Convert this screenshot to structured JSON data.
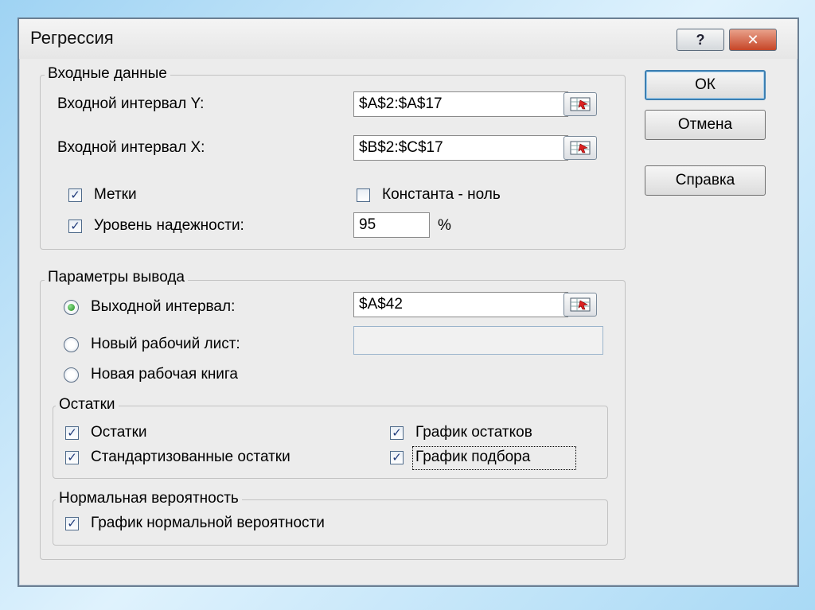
{
  "dialog": {
    "title": "Регрессия",
    "help_button": "?",
    "close_button": "✕"
  },
  "input": {
    "legend": "Входные данные",
    "y_label": "Входной интервал Y:",
    "y_value": "$A$2:$A$17",
    "x_label": "Входной интервал X:",
    "x_value": "$B$2:$C$17",
    "labels_label": "Метки",
    "labels_checked": true,
    "const_label": "Константа - ноль",
    "const_checked": false,
    "confidence_label": "Уровень надежности:",
    "confidence_checked": true,
    "confidence_value": "95",
    "percent": "%"
  },
  "output": {
    "legend": "Параметры вывода",
    "range_label": "Выходной интервал:",
    "range_value": "$A$42",
    "new_sheet_label": "Новый рабочий лист:",
    "new_sheet_value": "",
    "new_book_label": "Новая рабочая книга",
    "selected": "range"
  },
  "residuals": {
    "legend": "Остатки",
    "residuals_label": "Остатки",
    "standardized_label": "Стандартизованные остатки",
    "residual_plot_label": "График остатков",
    "fit_plot_label": "График подбора",
    "all_checked": true
  },
  "normal": {
    "legend": "Нормальная вероятность",
    "plot_label": "График нормальной вероятности",
    "checked": true
  },
  "buttons": {
    "ok": "ОК",
    "cancel": "Отмена",
    "help": "Справка"
  },
  "icons": {
    "ref": "range-select-icon",
    "check": "checkmark-icon"
  }
}
